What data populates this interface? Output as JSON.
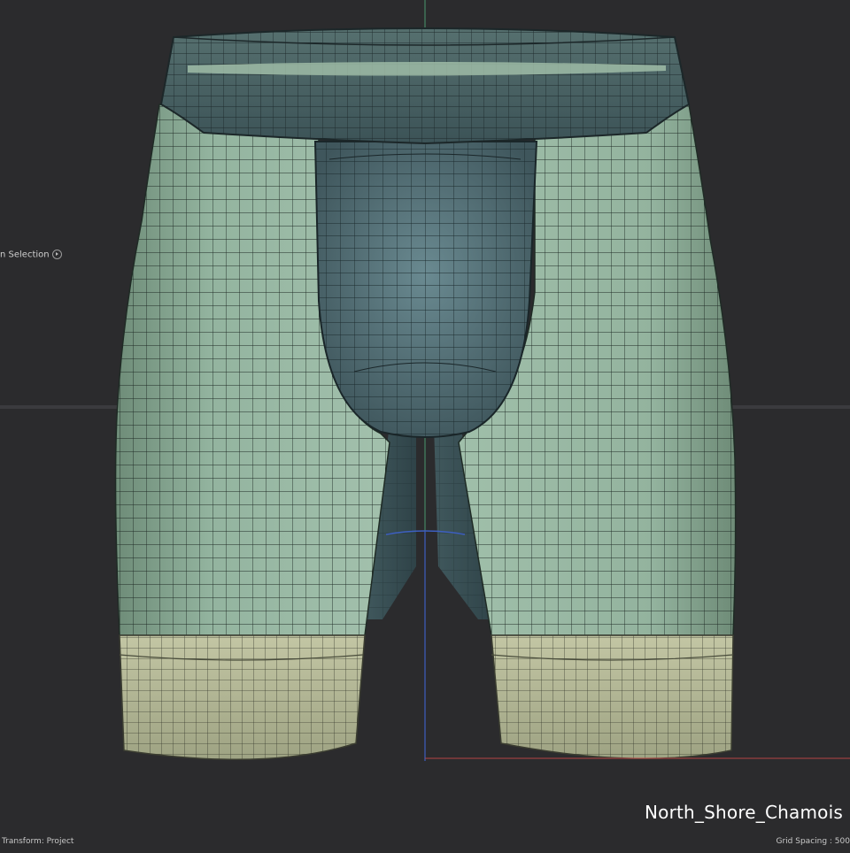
{
  "viewport": {
    "selection_label": "n Selection",
    "transform_label": "Transform: Project",
    "grid_label": "Grid Spacing : 500",
    "watermark": "North_Shore_Chamois"
  },
  "model": {
    "name": "North_Shore_Chamois",
    "colors": {
      "background": "#2b2b2d",
      "leg_fabric": "#8fb29b",
      "waistband": "#4a6266",
      "chamois_pad": "#57767d",
      "leg_cuff": "#b8bb99",
      "wire": "#27362f",
      "axis_green": "#4a9a70",
      "axis_blue": "#3d5fc0",
      "axis_red": "#b64545"
    }
  }
}
